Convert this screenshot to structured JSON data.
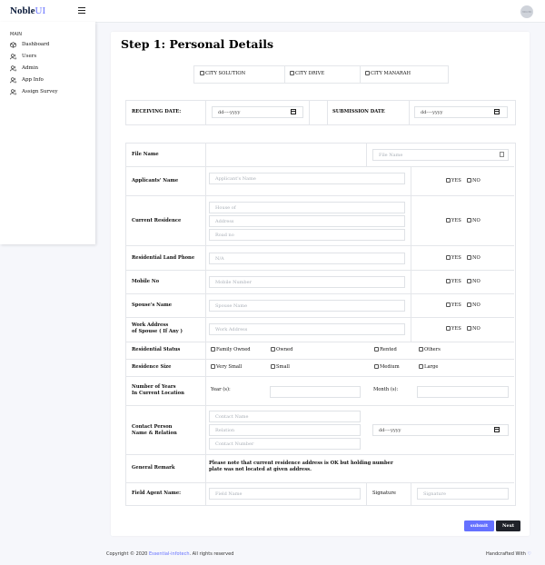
{
  "app": {
    "logo_main": "Noble",
    "logo_accent": "UI"
  },
  "sidebar": {
    "category": "MAIN",
    "items": [
      {
        "label": "Dashboard",
        "icon": "box-icon"
      },
      {
        "label": "Users",
        "icon": "users-icon"
      },
      {
        "label": "Admin",
        "icon": "users-icon"
      },
      {
        "label": "App Info",
        "icon": "users-icon"
      },
      {
        "label": "Assign Survey",
        "icon": "users-icon"
      }
    ]
  },
  "form": {
    "title": "Step 1: Personal Details",
    "cities": [
      "CITY SOLUTION",
      "CITY DRIVE",
      "CITY MANARAH"
    ],
    "receiving_date_label": "RECEIVING DATE:",
    "submission_date_label": "SUBMISSION DATE",
    "date_placeholder": "dd----yyyy",
    "file_name_label": "File Name",
    "file_name_placeholder": "File Name",
    "applicant_label": "Applicants' Name",
    "applicant_placeholder": "Applicant's Name",
    "yes": "YES",
    "no": "NO",
    "current_residence_label": "Current Residence",
    "house_placeholder": "House of",
    "address_placeholder": "Address",
    "road_placeholder": "Road no",
    "land_phone_label": "Residential Land Phone",
    "land_phone_placeholder": "N/A",
    "mobile_label": "Mobile No",
    "mobile_placeholder": "Mobile Number",
    "spouse_label": "Spouse's Name",
    "spouse_placeholder": "Spouse Name",
    "work_address_label_1": "Work Address",
    "work_address_label_2": "of Spouse ( If Any )",
    "work_address_placeholder": "Work Address",
    "residential_status_label": "Residential Status",
    "status_options": [
      "Family Owned",
      "Owned",
      "Rented",
      "Others"
    ],
    "residence_size_label": "Residence Size",
    "size_options": [
      "Very Small",
      "Small",
      "Medium",
      "Large"
    ],
    "years_label_1": "Number of Years",
    "years_label_2": "In Current Location",
    "year_label": "Year (s):",
    "month_label": "Month (s):",
    "contact_label_1": "Contact Person",
    "contact_label_2": "Name & Relation",
    "contact_name_placeholder": "Contact Name",
    "relation_placeholder": "Relation",
    "contact_number_placeholder": "Contact Number",
    "general_remark_label": "General Remark",
    "general_remark_text_1": "Please note that current residence address is OK but holding number",
    "general_remark_text_2": "plate was not located at given address.",
    "field_agent_label": "Field Agent Name:",
    "field_agent_placeholder": "Field Name",
    "signature_label": "Signature",
    "signature_placeholder": "Signature",
    "submit_label": "submit",
    "next_label": "Next"
  },
  "footer": {
    "copyright_prefix": "Copyright © 2020",
    "copyright_link": "Essential-infotech",
    "copyright_suffix": ". All rights reserved",
    "handcrafted": "Handcrafted With"
  },
  "colors": {
    "accent": "#6571ff",
    "next_button": "#1f2229"
  }
}
